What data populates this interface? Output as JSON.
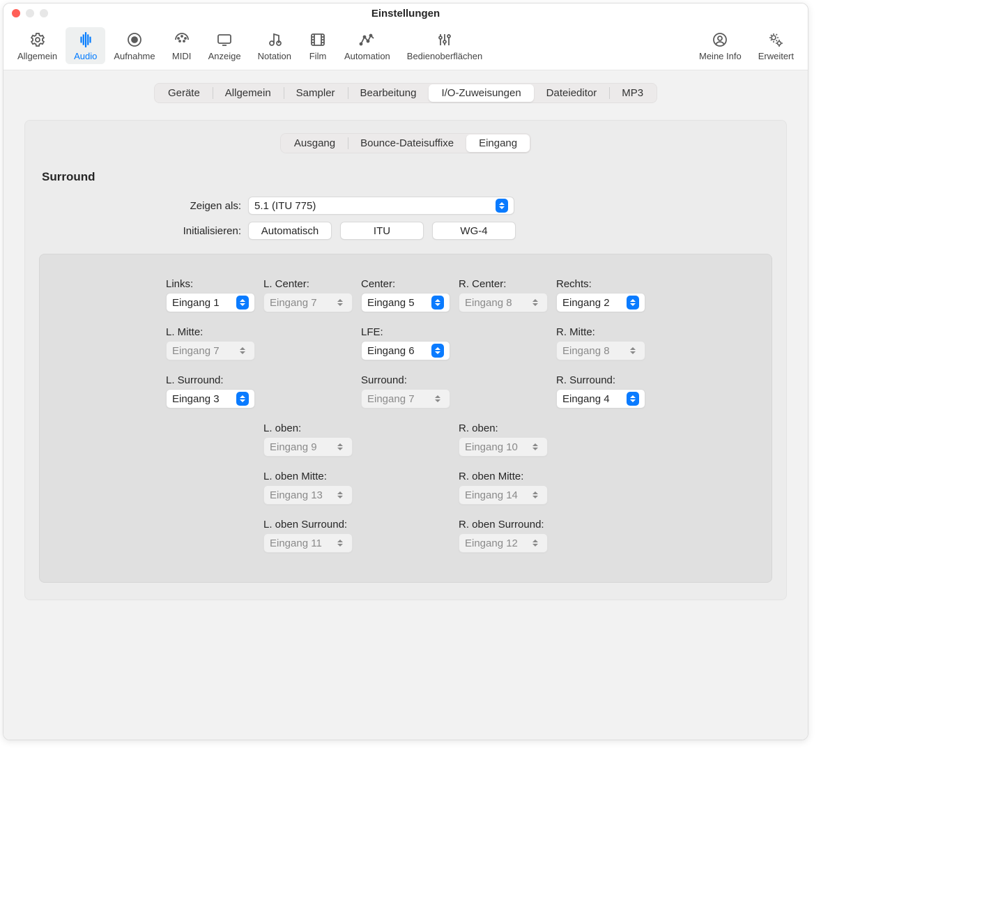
{
  "window": {
    "title": "Einstellungen"
  },
  "toolbar": {
    "items": [
      {
        "label": "Allgemein"
      },
      {
        "label": "Audio"
      },
      {
        "label": "Aufnahme"
      },
      {
        "label": "MIDI"
      },
      {
        "label": "Anzeige"
      },
      {
        "label": "Notation"
      },
      {
        "label": "Film"
      },
      {
        "label": "Automation"
      },
      {
        "label": "Bedienoberflächen"
      },
      {
        "label": "Meine Info"
      },
      {
        "label": "Erweitert"
      }
    ]
  },
  "segbar1": {
    "items": [
      "Geräte",
      "Allgemein",
      "Sampler",
      "Bearbeitung",
      "I/O-Zuweisungen",
      "Dateieditor",
      "MP3"
    ]
  },
  "segbar2": {
    "items": [
      "Ausgang",
      "Bounce-Dateisuffixe",
      "Eingang"
    ]
  },
  "section_title": "Surround",
  "show_as": {
    "label": "Zeigen als:",
    "value": "5.1 (ITU 775)"
  },
  "initialize": {
    "label": "Initialisieren:",
    "b1": "Automatisch",
    "b2": "ITU",
    "b3": "WG-4"
  },
  "cells": {
    "links": {
      "lab": "Links:",
      "val": "Eingang 1",
      "enabled": true
    },
    "lcenter": {
      "lab": "L. Center:",
      "val": "Eingang 7",
      "enabled": false
    },
    "center": {
      "lab": "Center:",
      "val": "Eingang 5",
      "enabled": true
    },
    "rcenter": {
      "lab": "R. Center:",
      "val": "Eingang 8",
      "enabled": false
    },
    "rechts": {
      "lab": "Rechts:",
      "val": "Eingang 2",
      "enabled": true
    },
    "lmitte": {
      "lab": "L. Mitte:",
      "val": "Eingang 7",
      "enabled": false
    },
    "lfe": {
      "lab": "LFE:",
      "val": "Eingang 6",
      "enabled": true
    },
    "rmitte": {
      "lab": "R. Mitte:",
      "val": "Eingang 8",
      "enabled": false
    },
    "lsurround": {
      "lab": "L. Surround:",
      "val": "Eingang 3",
      "enabled": true
    },
    "surround": {
      "lab": "Surround:",
      "val": "Eingang 7",
      "enabled": false
    },
    "rsurround": {
      "lab": "R. Surround:",
      "val": "Eingang 4",
      "enabled": true
    },
    "loben": {
      "lab": "L. oben:",
      "val": "Eingang 9",
      "enabled": false
    },
    "roben": {
      "lab": "R. oben:",
      "val": "Eingang 10",
      "enabled": false
    },
    "lobenmitte": {
      "lab": "L. oben Mitte:",
      "val": "Eingang 13",
      "enabled": false
    },
    "robenmitte": {
      "lab": "R. oben Mitte:",
      "val": "Eingang 14",
      "enabled": false
    },
    "lobensurr": {
      "lab": "L. oben Surround:",
      "val": "Eingang 11",
      "enabled": false
    },
    "robensurr": {
      "lab": "R. oben Surround:",
      "val": "Eingang 12",
      "enabled": false
    }
  }
}
